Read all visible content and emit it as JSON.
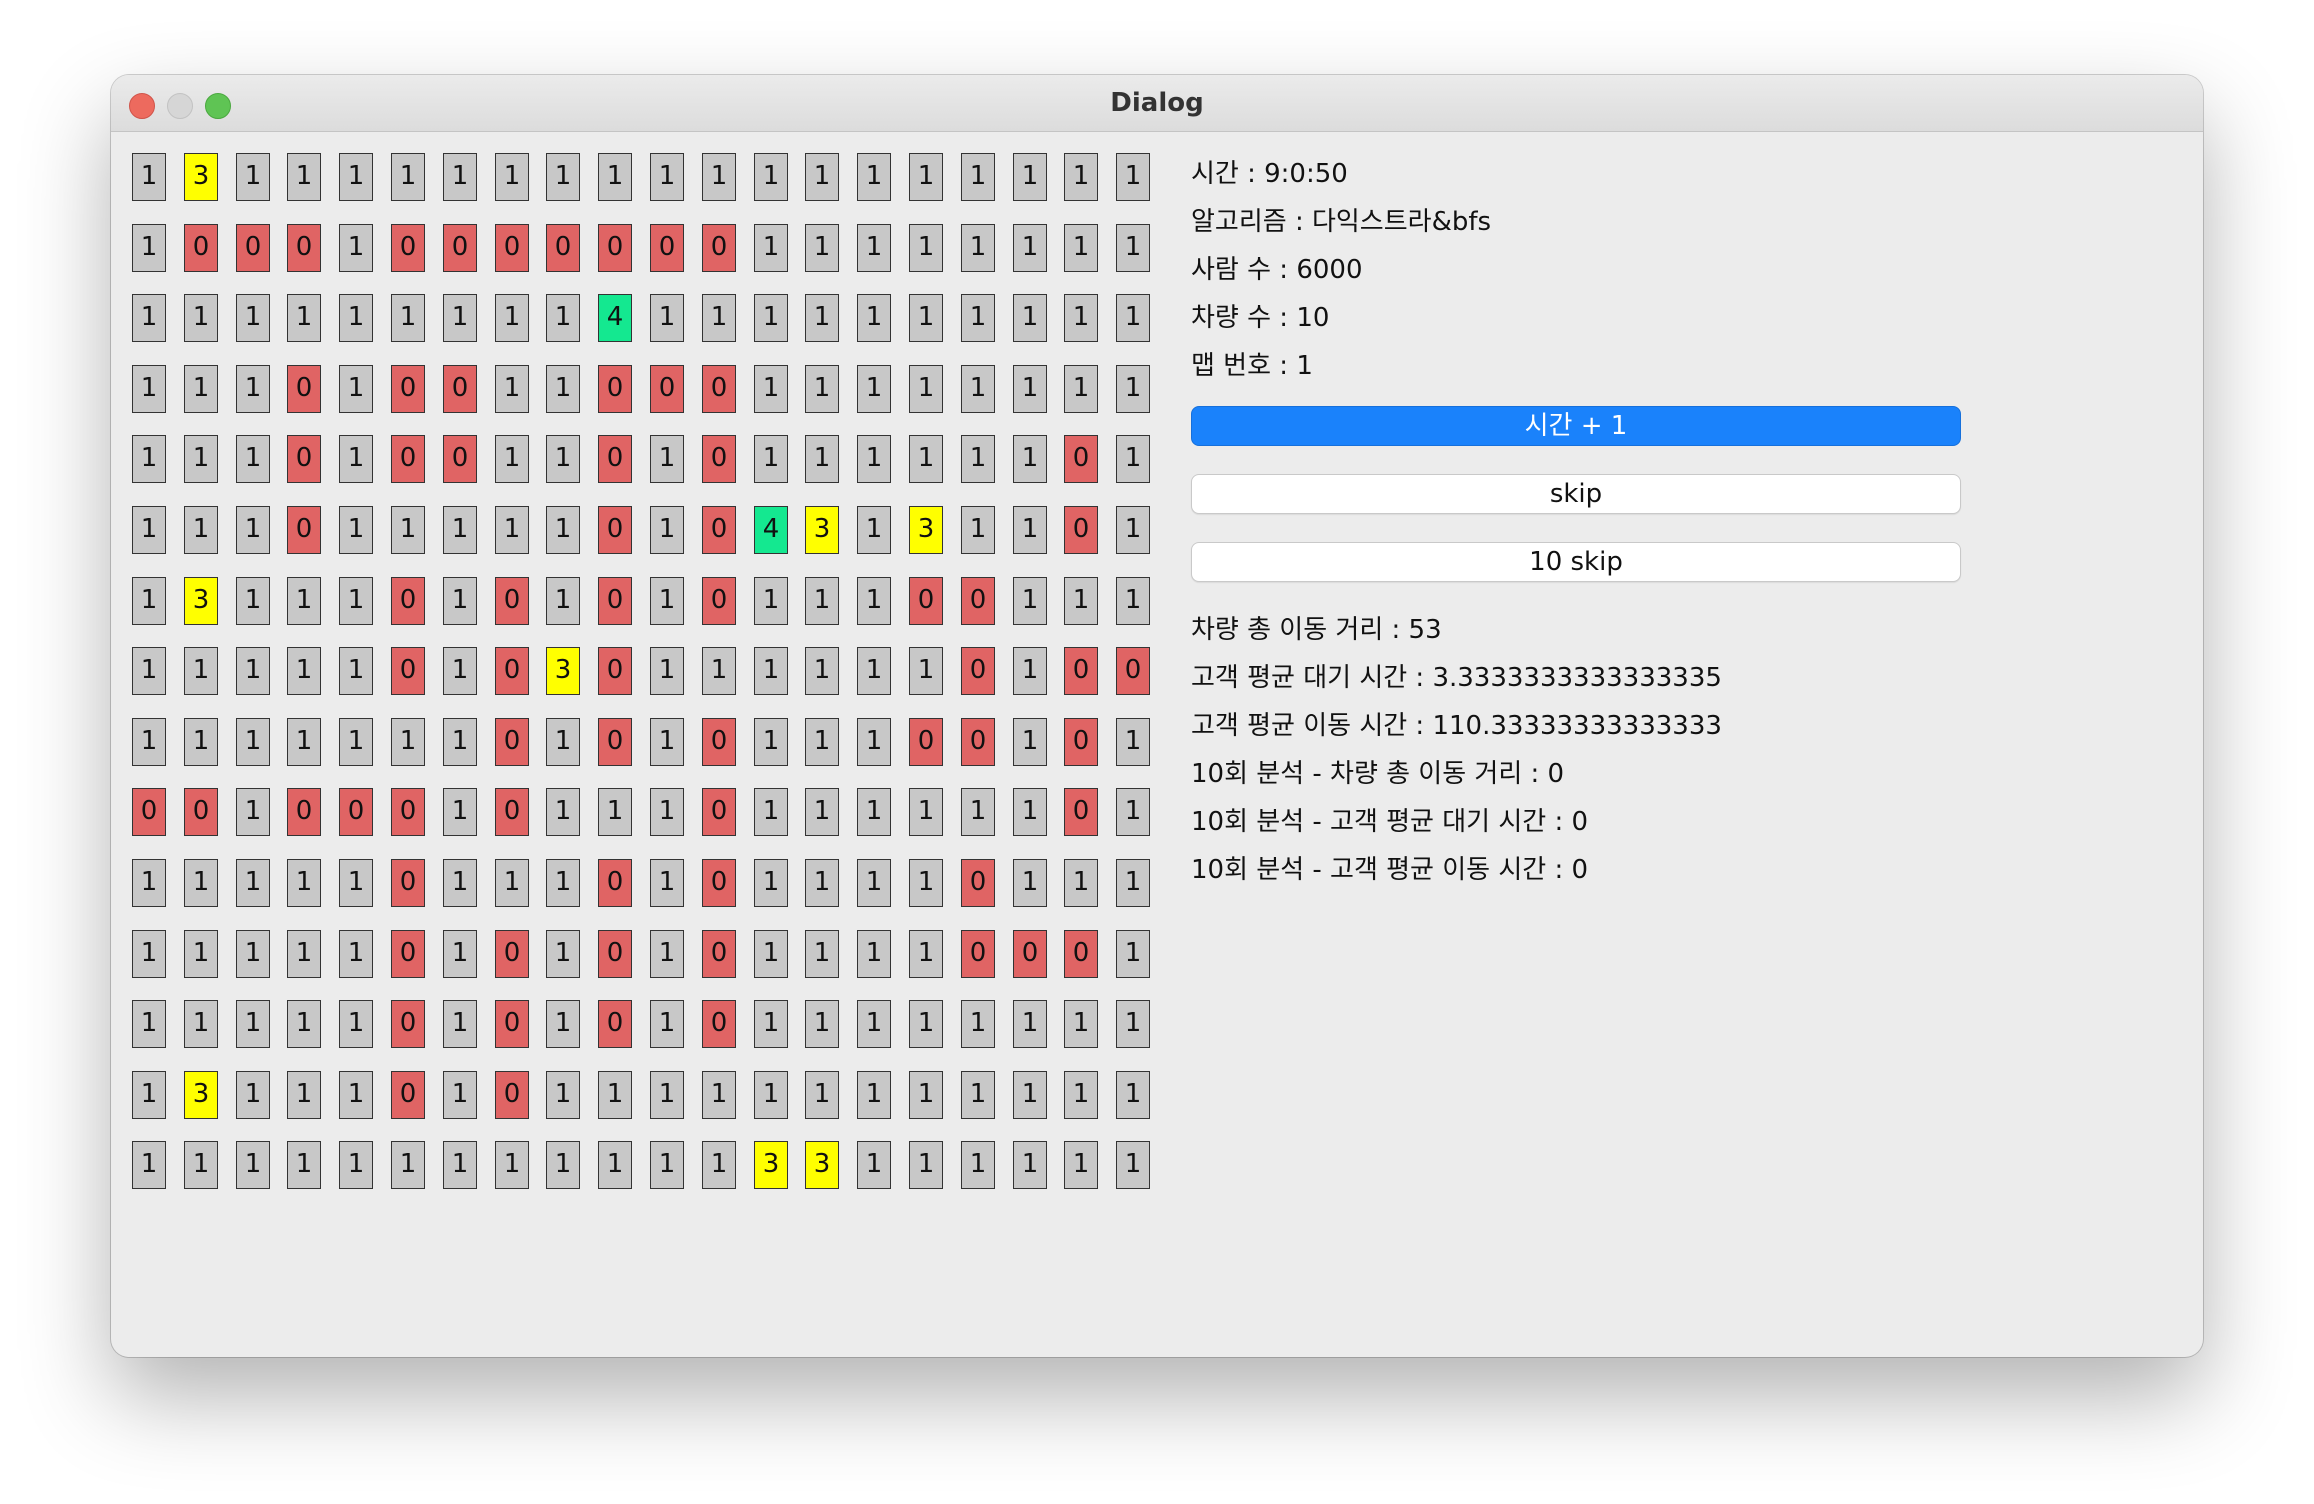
{
  "window": {
    "title": "Dialog"
  },
  "colors": {
    "road": "#c8c8c8",
    "block": "#e06464",
    "customer": "#ffff00",
    "vehicle": "#14e890"
  },
  "grid": [
    [
      1,
      3,
      1,
      1,
      1,
      1,
      1,
      1,
      1,
      1,
      1,
      1,
      1,
      1,
      1,
      1,
      1,
      1,
      1,
      1
    ],
    [
      1,
      0,
      0,
      0,
      1,
      0,
      0,
      0,
      0,
      0,
      0,
      0,
      1,
      1,
      1,
      1,
      1,
      1,
      1,
      1
    ],
    [
      1,
      1,
      1,
      1,
      1,
      1,
      1,
      1,
      1,
      4,
      1,
      1,
      1,
      1,
      1,
      1,
      1,
      1,
      1,
      1
    ],
    [
      1,
      1,
      1,
      0,
      1,
      0,
      0,
      1,
      1,
      0,
      0,
      0,
      1,
      1,
      1,
      1,
      1,
      1,
      1,
      1
    ],
    [
      1,
      1,
      1,
      0,
      1,
      0,
      0,
      1,
      1,
      0,
      1,
      0,
      1,
      1,
      1,
      1,
      1,
      1,
      0,
      1
    ],
    [
      1,
      1,
      1,
      0,
      1,
      1,
      1,
      1,
      1,
      0,
      1,
      0,
      4,
      3,
      1,
      3,
      1,
      1,
      0,
      1
    ],
    [
      1,
      3,
      1,
      1,
      1,
      0,
      1,
      0,
      1,
      0,
      1,
      0,
      1,
      1,
      1,
      0,
      0,
      1,
      1,
      1
    ],
    [
      1,
      1,
      1,
      1,
      1,
      0,
      1,
      0,
      3,
      0,
      1,
      1,
      1,
      1,
      1,
      1,
      0,
      1,
      0,
      0
    ],
    [
      1,
      1,
      1,
      1,
      1,
      1,
      1,
      0,
      1,
      0,
      1,
      0,
      1,
      1,
      1,
      0,
      0,
      1,
      0,
      1
    ],
    [
      0,
      0,
      1,
      0,
      0,
      0,
      1,
      0,
      1,
      1,
      1,
      0,
      1,
      1,
      1,
      1,
      1,
      1,
      0,
      1
    ],
    [
      1,
      1,
      1,
      1,
      1,
      0,
      1,
      1,
      1,
      0,
      1,
      0,
      1,
      1,
      1,
      1,
      0,
      1,
      1,
      1
    ],
    [
      1,
      1,
      1,
      1,
      1,
      0,
      1,
      0,
      1,
      0,
      1,
      0,
      1,
      1,
      1,
      1,
      0,
      0,
      0,
      1
    ],
    [
      1,
      1,
      1,
      1,
      1,
      0,
      1,
      0,
      1,
      0,
      1,
      0,
      1,
      1,
      1,
      1,
      1,
      1,
      1,
      1
    ],
    [
      1,
      3,
      1,
      1,
      1,
      0,
      1,
      0,
      1,
      1,
      1,
      1,
      1,
      1,
      1,
      1,
      1,
      1,
      1,
      1
    ],
    [
      1,
      1,
      1,
      1,
      1,
      1,
      1,
      1,
      1,
      1,
      1,
      1,
      3,
      3,
      1,
      1,
      1,
      1,
      1,
      1
    ]
  ],
  "info": {
    "time": "시간 : 9:0:50",
    "algorithm": "알고리즘 : 다익스트라&bfs",
    "people": "사람 수 : 6000",
    "vehicles": "차량 수 : 10",
    "map": "맵 번호 : 1"
  },
  "buttons": {
    "time_plus": "시간 + 1",
    "skip": "skip",
    "skip10": "10 skip"
  },
  "stats": {
    "total_distance": "차량 총 이동 거리 : 53",
    "avg_wait": "고객 평균 대기 시간 : 3.3333333333333335",
    "avg_travel": "고객 평균 이동 시간 : 110.33333333333333",
    "a10_distance": "10회 분석 - 차량 총 이동 거리 : 0",
    "a10_wait": "10회 분석 - 고객 평균 대기 시간 : 0",
    "a10_travel": "10회 분석 - 고객 평균 이동 시간 : 0"
  }
}
